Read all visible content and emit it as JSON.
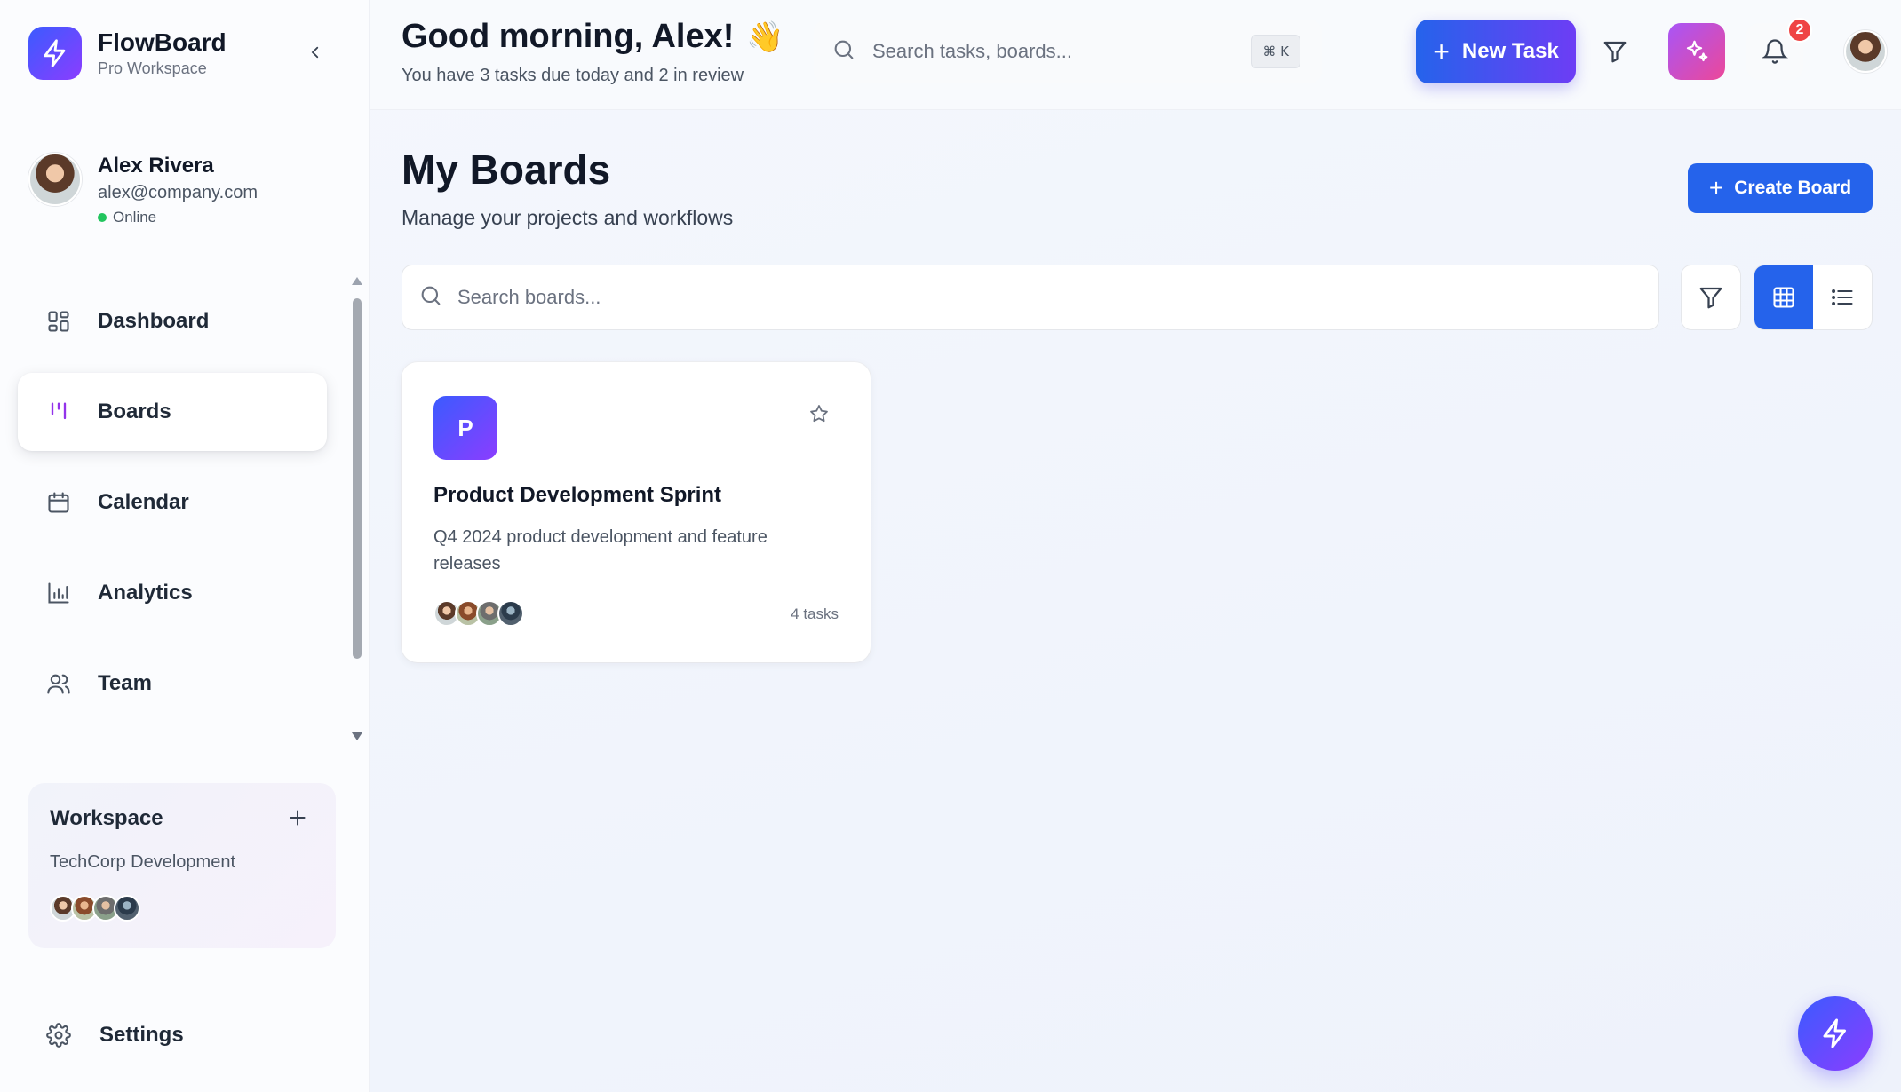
{
  "brand": {
    "name": "FlowBoard",
    "subtitle": "Pro Workspace",
    "logo_icon": "lightning-icon"
  },
  "user": {
    "name": "Alex Rivera",
    "email": "alex@company.com",
    "status": "Online"
  },
  "nav": {
    "items": [
      {
        "label": "Dashboard",
        "icon": "grid-icon",
        "active": false
      },
      {
        "label": "Boards",
        "icon": "kanban-icon",
        "active": true
      },
      {
        "label": "Calendar",
        "icon": "calendar-icon",
        "active": false
      },
      {
        "label": "Analytics",
        "icon": "bar-chart-icon",
        "active": false
      },
      {
        "label": "Team",
        "icon": "users-icon",
        "active": false
      }
    ],
    "settings_label": "Settings"
  },
  "workspace": {
    "title": "Workspace",
    "name": "TechCorp Development",
    "member_count": 4
  },
  "header": {
    "greeting": "Good morning, Alex!",
    "wave": "👋",
    "subtitle": "You have 3 tasks due today and 2 in review",
    "search_placeholder": "Search tasks, boards...",
    "shortcut": "⌘ K",
    "new_task_label": "New Task",
    "notification_count": "2"
  },
  "page": {
    "title": "My Boards",
    "subtitle": "Manage your projects and workflows",
    "create_label": "Create Board",
    "search_placeholder": "Search boards...",
    "view_mode": "grid"
  },
  "boards": [
    {
      "initial": "P",
      "title": "Product Development Sprint",
      "description": "Q4 2024 product development and feature releases",
      "tasks_label": "4 tasks",
      "member_count": 4,
      "starred": false
    }
  ],
  "colors": {
    "accent": "#2563eb",
    "brand_gradient_start": "#3b5bff",
    "brand_gradient_end": "#8b3dff",
    "ai_gradient_start": "#a855f7",
    "ai_gradient_end": "#ec4899",
    "badge": "#ef4444",
    "online": "#22c55e"
  }
}
